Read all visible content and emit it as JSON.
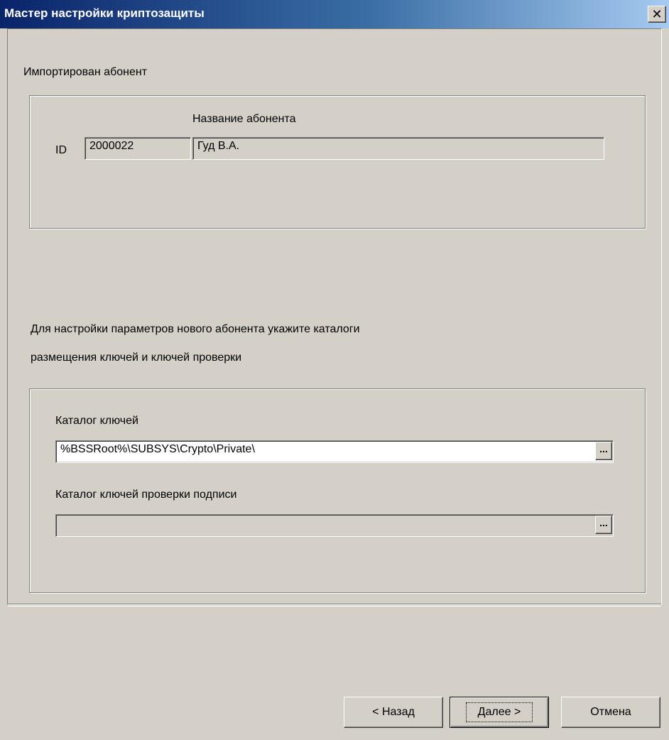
{
  "window": {
    "title": "Мастер настройки криптозащиты",
    "close_icon": "close-icon",
    "close_glyph": "✕"
  },
  "section_imported": {
    "heading": "Импортирован абонент",
    "id_label": "ID",
    "id_value": "2000022",
    "name_label": "Название абонента",
    "name_value": "Гуд В.А."
  },
  "instructions": {
    "line1": "Для настройки параметров нового абонента укажите каталоги",
    "line2": "размещения ключей и ключей проверки"
  },
  "section_dirs": {
    "keys_label": "Каталог ключей",
    "keys_value": "%BSSRoot%\\SUBSYS\\Crypto\\Private\\",
    "sig_keys_label": "Каталог ключей проверки подписи",
    "sig_keys_value": "",
    "browse_glyph": "..."
  },
  "buttons": {
    "back": "< Назад",
    "next": "Далее >",
    "cancel": "Отмена"
  }
}
